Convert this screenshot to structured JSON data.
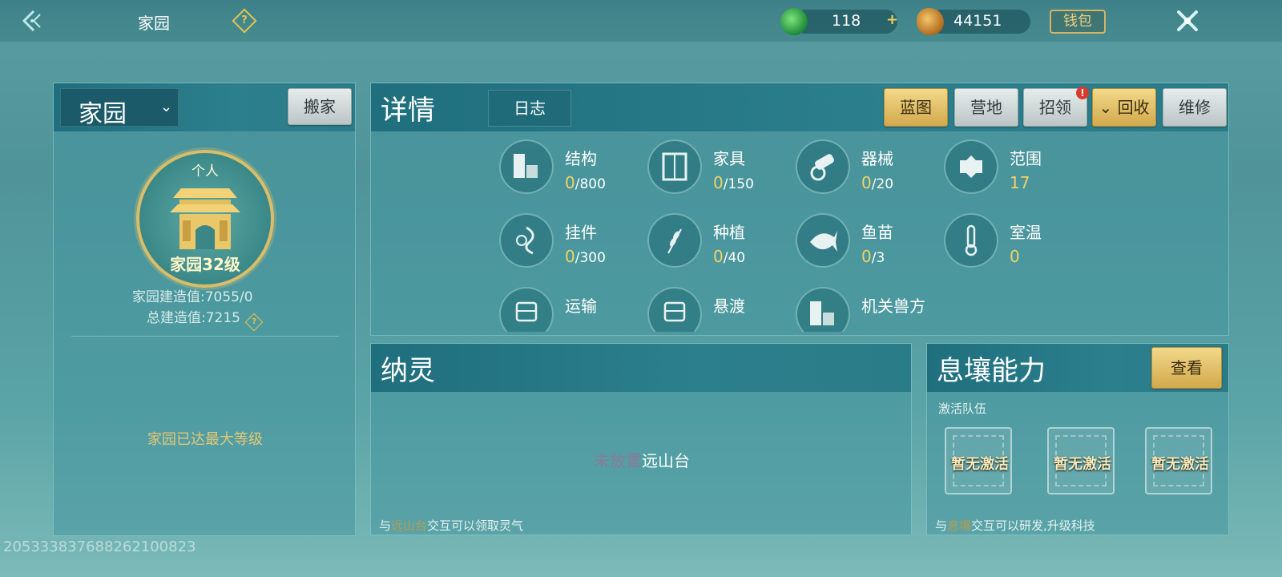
{
  "topbar": {
    "title": "家园",
    "help": "?",
    "jade_amount": "118",
    "plus": "+",
    "coin_amount": "44151",
    "wallet_label": "钱包"
  },
  "left_panel": {
    "home_select": "家园",
    "move_button": "搬家",
    "emblem_top_label": "个人",
    "level_label": "家园32级",
    "build_value_label": "家园建造值:7055/0",
    "total_build_label": "总建造值:7215",
    "help": "?",
    "max_level_text": "家园已达最大等级"
  },
  "detail_panel": {
    "title": "详情",
    "log_tab": "日志",
    "toolbar": {
      "blueprint": "蓝图",
      "camp": "营地",
      "recruit": "招领",
      "recruit_badge": "!",
      "recycle": "回收",
      "repair": "维修"
    },
    "stats": [
      {
        "name": "结构",
        "value": "0",
        "max": "/800",
        "icon": "building-blocks-icon"
      },
      {
        "name": "家具",
        "value": "0",
        "max": "/150",
        "icon": "wardrobe-icon"
      },
      {
        "name": "器械",
        "value": "0",
        "max": "/20",
        "icon": "cannon-icon"
      },
      {
        "name": "范围",
        "value": "17",
        "max": "",
        "icon": "range-icon"
      },
      {
        "name": "挂件",
        "value": "0",
        "max": "/300",
        "icon": "ornament-icon"
      },
      {
        "name": "种植",
        "value": "0",
        "max": "/40",
        "icon": "wheat-icon"
      },
      {
        "name": "鱼苗",
        "value": "0",
        "max": "/3",
        "icon": "fish-icon"
      },
      {
        "name": "室温",
        "value": "0",
        "max": "",
        "icon": "thermometer-icon"
      },
      {
        "name": "运输",
        "value": "",
        "max": "",
        "icon": "carriage-icon"
      },
      {
        "name": "悬渡",
        "value": "",
        "max": "",
        "icon": "carriage-icon"
      },
      {
        "name": "机关兽方",
        "value": "",
        "max": "",
        "icon": "building-blocks-icon"
      }
    ]
  },
  "naling_panel": {
    "title": "纳灵",
    "center_dim": "未放置",
    "center_text": "远山台",
    "footer_pre": "与",
    "footer_dim": "远山台",
    "footer_post": "交互可以领取灵气"
  },
  "xirang_panel": {
    "title": "息壤能力",
    "view_button": "查看",
    "team_label": "激活队伍",
    "slots": [
      "暂无激活",
      "暂无激活",
      "暂无激活"
    ],
    "footer_pre": "与",
    "footer_dim": "息壤",
    "footer_post": "交互可以研发,升级科技"
  },
  "bottom_id": "205333837688262100823",
  "colors": {
    "gold_text": "#f0d267",
    "panel_head": "#1f6f7e",
    "gold_button": "#d2a94d"
  }
}
